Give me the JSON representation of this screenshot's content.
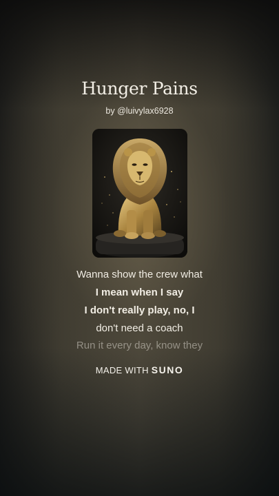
{
  "song": {
    "title": "Hunger Pains",
    "byline": "by @luivylax6928"
  },
  "cover_art": {
    "icon": "lion-statue-artwork"
  },
  "lyrics": [
    {
      "text": "Wanna show the crew what",
      "state": "normal"
    },
    {
      "text": "I mean when I say",
      "state": "active"
    },
    {
      "text": "I don't really play, no, I",
      "state": "active"
    },
    {
      "text": "don't need a coach",
      "state": "normal"
    },
    {
      "text": "Run it every day, know they",
      "state": "dim"
    }
  ],
  "watermark": {
    "prefix": "MADE WITH",
    "brand": "SUNO"
  },
  "colors": {
    "text": "#f1ede4",
    "accent_gold": "#b89a5a"
  }
}
